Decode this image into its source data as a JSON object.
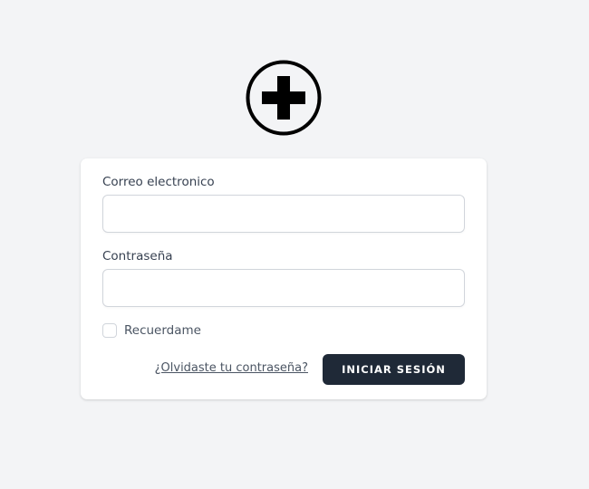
{
  "logo": {
    "icon": "medical-cross-icon",
    "color": "#000000"
  },
  "form": {
    "email_label": "Correo electronico",
    "email_value": "",
    "email_placeholder": "",
    "password_label": "Contraseña",
    "password_value": "",
    "password_placeholder": "",
    "remember_label": "Recuerdame",
    "remember_checked": false,
    "forgot_link": "¿Olvidaste tu contraseña?",
    "submit_label": "INICIAR SESIÓN"
  },
  "colors": {
    "background": "#f3f4f6",
    "card": "#ffffff",
    "button": "#1f2937",
    "button_text": "#ffffff"
  }
}
